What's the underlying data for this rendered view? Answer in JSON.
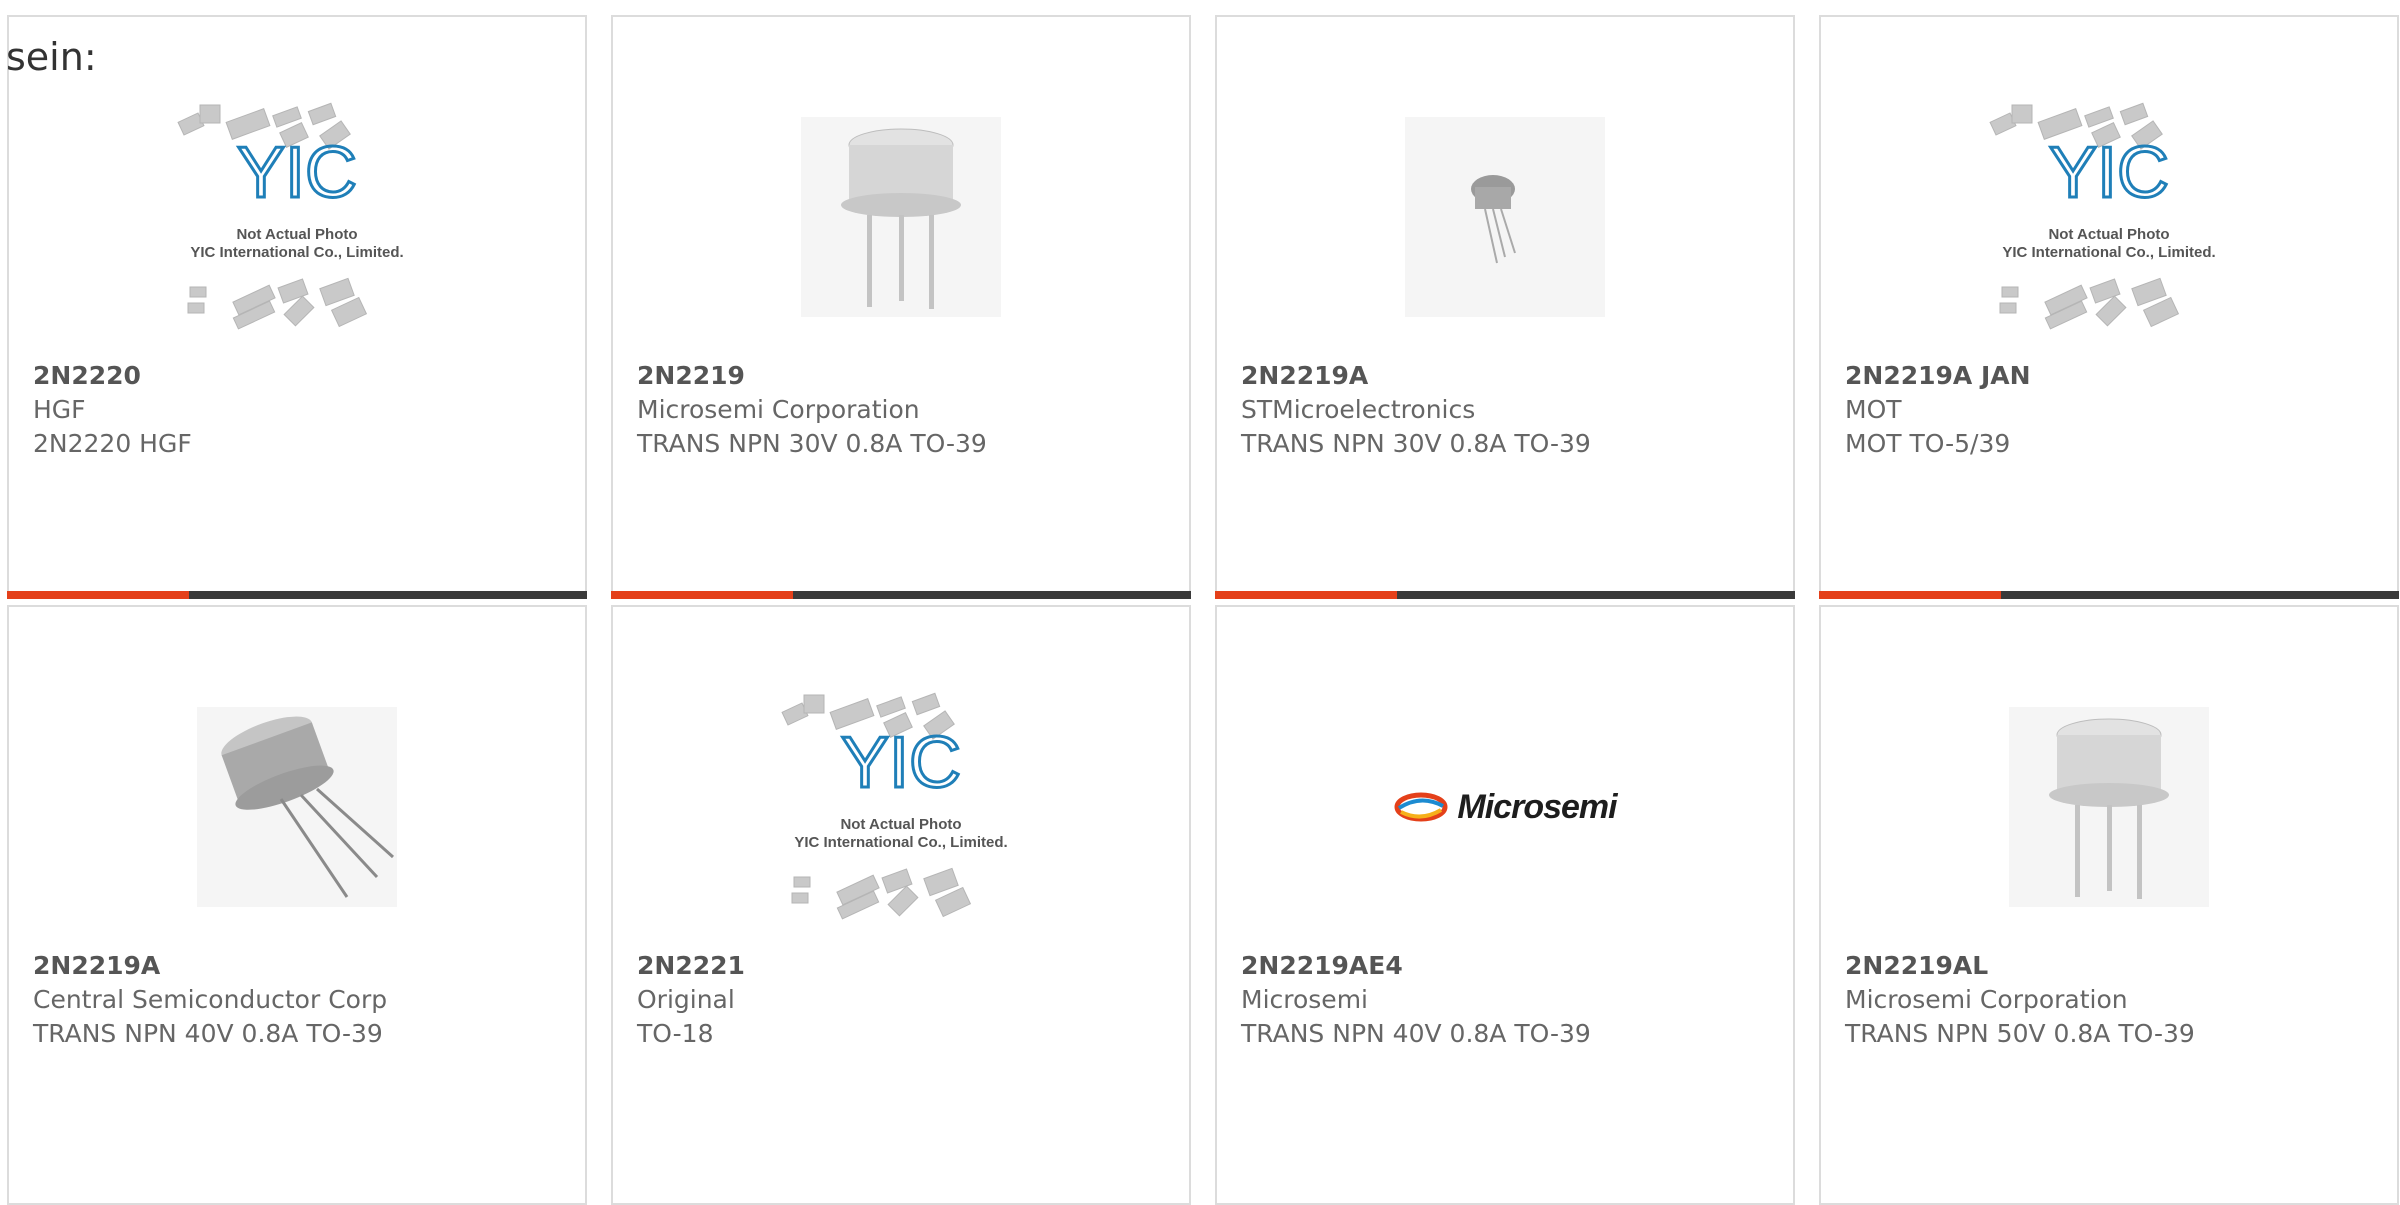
{
  "section_label": "sein:",
  "products": [
    {
      "part": "2N2220",
      "manufacturer": "HGF",
      "description": "2N2220 HGF",
      "image": "yic-placeholder-icon"
    },
    {
      "part": "2N2219",
      "manufacturer": "Microsemi Corporation",
      "description": "TRANS NPN 30V 0.8A TO-39",
      "image": "to39-can-icon"
    },
    {
      "part": "2N2219A",
      "manufacturer": "STMicroelectronics",
      "description": "TRANS NPN 30V 0.8A TO-39",
      "image": "small-transistor-icon"
    },
    {
      "part": "2N2219A JAN",
      "manufacturer": "MOT",
      "description": "MOT TO-5/39",
      "image": "yic-placeholder-icon"
    },
    {
      "part": "2N2219A",
      "manufacturer": "Central Semiconductor Corp",
      "description": "TRANS NPN 40V 0.8A TO-39",
      "image": "angled-transistor-icon"
    },
    {
      "part": "2N2221",
      "manufacturer": "Original",
      "description": "TO-18",
      "image": "yic-placeholder-icon"
    },
    {
      "part": "2N2219AE4",
      "manufacturer": "Microsemi",
      "description": "TRANS NPN 40V 0.8A TO-39",
      "image": "microsemi-logo"
    },
    {
      "part": "2N2219AL",
      "manufacturer": "Microsemi Corporation",
      "description": "TRANS NPN 50V 0.8A TO-39",
      "image": "to39-can-icon"
    }
  ],
  "placeholder": {
    "line1": "Not Actual Photo",
    "line2": "YIC International Co., Limited.",
    "logo": "YIC"
  },
  "microsemi_logo_text": "Microsemi",
  "colors": {
    "accent": "#e4401a",
    "bar": "#3a3a3a",
    "border": "#dcdcdc",
    "text": "#666666"
  }
}
